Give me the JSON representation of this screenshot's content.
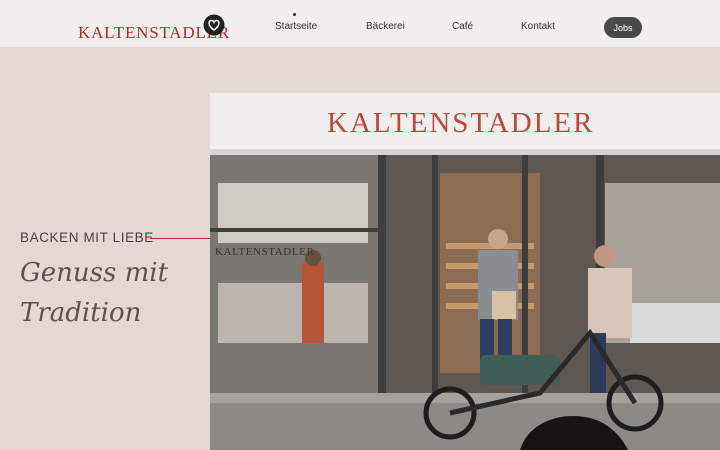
{
  "header": {
    "logo_text": "KALTENSTADLER",
    "logo_icon": "heart-badge-icon",
    "nav": [
      {
        "label": "Startseite",
        "active": true
      },
      {
        "label": "Bäckerei"
      },
      {
        "label": "Café"
      },
      {
        "label": "Kontakt"
      }
    ],
    "jobs_label": "Jobs"
  },
  "hero": {
    "eyebrow": "BACKEN MIT LIEBE",
    "headline_line1": "Genuss mit",
    "headline_line2": "Tradition"
  },
  "photo": {
    "storefront_sign": "KALTENSTADLER",
    "window_sign": "KALTENSTADLER"
  },
  "colors": {
    "brand_red": "#b02a2e",
    "page_background": "#e3d8d3",
    "header_background": "#f3efee",
    "button_dark": "#4a4a4a"
  }
}
